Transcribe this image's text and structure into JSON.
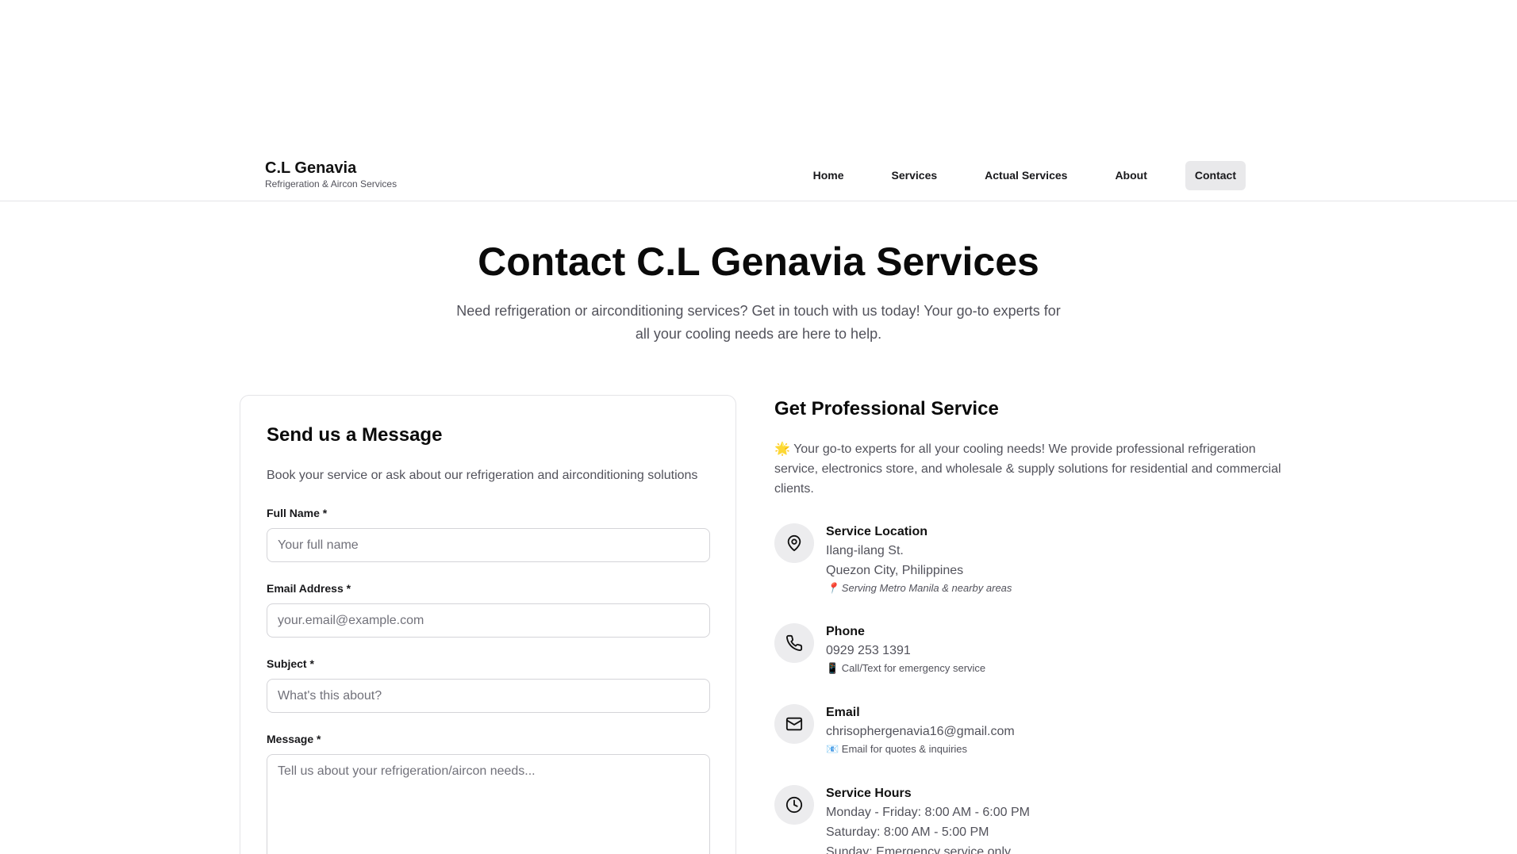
{
  "brand": {
    "name": "C.L Genavia",
    "tagline": "Refrigeration & Aircon Services"
  },
  "nav": {
    "items": [
      "Home",
      "Services",
      "Actual Services",
      "About",
      "Contact"
    ],
    "active": "Contact"
  },
  "hero": {
    "title": "Contact C.L Genavia Services",
    "subtitle_line1": "Need refrigeration or airconditioning services? Get in touch with us today! Your go-to experts for",
    "subtitle_line2": "all your cooling needs are here to help."
  },
  "form": {
    "title": "Send us a Message",
    "description": "Book your service or ask about our refrigeration and airconditioning solutions",
    "full_name": {
      "label": "Full Name *",
      "placeholder": "Your full name",
      "value": ""
    },
    "email": {
      "label": "Email Address *",
      "placeholder": "your.email@example.com",
      "value": ""
    },
    "subject": {
      "label": "Subject *",
      "placeholder": "What's this about?",
      "value": ""
    },
    "message": {
      "label": "Message *",
      "placeholder": "Tell us about your refrigeration/aircon needs...",
      "value": ""
    }
  },
  "info": {
    "title": "Get Professional Service",
    "intro": "🌟 Your go-to experts for all your cooling needs! We provide professional refrigeration service, electronics store, and wholesale & supply solutions for residential and commercial clients.",
    "location": {
      "icon": "map-pin-icon",
      "title": "Service Location",
      "line1": "Ilang-ilang St.",
      "line2": "Quezon City, Philippines",
      "note": "📍 Serving Metro Manila & nearby areas"
    },
    "phone": {
      "icon": "phone-icon",
      "title": "Phone",
      "line1": "0929 253 1391",
      "note": "📱 Call/Text for emergency service"
    },
    "email": {
      "icon": "mail-icon",
      "title": "Email",
      "line1": "chrisophergenavia16@gmail.com",
      "note": "📧 Email for quotes & inquiries"
    },
    "hours": {
      "icon": "clock-icon",
      "title": "Service Hours",
      "line1": "Monday - Friday: 8:00 AM - 6:00 PM",
      "line2": "Saturday: 8:00 AM - 5:00 PM",
      "line3": "Sunday: Emergency service only"
    }
  }
}
